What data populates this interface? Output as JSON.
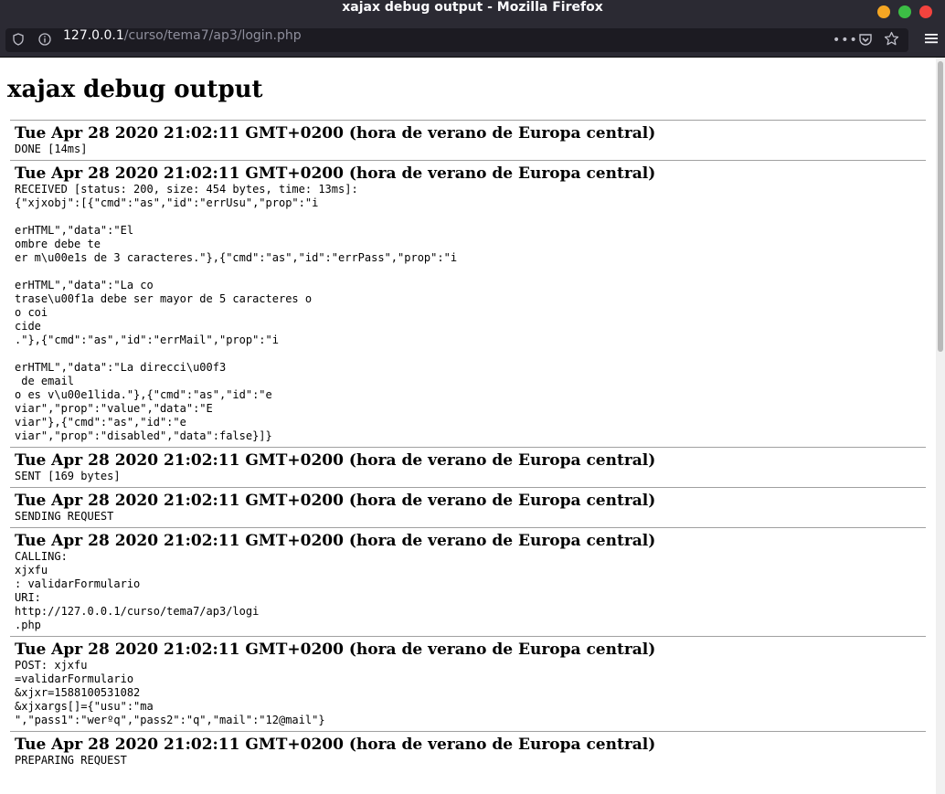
{
  "window": {
    "title": "xajax debug output - Mozilla Firefox",
    "controls": [
      "minimize",
      "maximize",
      "close"
    ],
    "control_colors": [
      "#f5a623",
      "#3cbe45",
      "#f3433e"
    ]
  },
  "urlbar": {
    "url_host": "127.0.0.1",
    "url_path": "/curso/tema7/ap3/login.php",
    "icons": [
      "shield-icon",
      "info-icon",
      "more-dots-icon",
      "pocket-icon",
      "star-icon"
    ]
  },
  "toolbar": {
    "menu_icon": "hamburger-menu-icon"
  },
  "page": {
    "title": "xajax debug output",
    "entries": [
      {
        "timestamp": "Tue Apr 28 2020 21:02:11 GMT+0200 (hora de verano de Europa central)",
        "body": "DONE [14ms]"
      },
      {
        "timestamp": "Tue Apr 28 2020 21:02:11 GMT+0200 (hora de verano de Europa central)",
        "body": "RECEIVED [status: 200, size: 454 bytes, time: 13ms]:\n{\"xjxobj\":[{\"cmd\":\"as\",\"id\":\"errUsu\",\"prop\":\"i\n\nerHTML\",\"data\":\"El\nombre debe te\ner m\\u00e1s de 3 caracteres.\"},{\"cmd\":\"as\",\"id\":\"errPass\",\"prop\":\"i\n\nerHTML\",\"data\":\"La co\ntrase\\u00f1a debe ser mayor de 5 caracteres o\no coi\ncide\n.\"},{\"cmd\":\"as\",\"id\":\"errMail\",\"prop\":\"i\n\nerHTML\",\"data\":\"La direcci\\u00f3\n de email\no es v\\u00e1lida.\"},{\"cmd\":\"as\",\"id\":\"e\nviar\",\"prop\":\"value\",\"data\":\"E\nviar\"},{\"cmd\":\"as\",\"id\":\"e\nviar\",\"prop\":\"disabled\",\"data\":false}]}"
      },
      {
        "timestamp": "Tue Apr 28 2020 21:02:11 GMT+0200 (hora de verano de Europa central)",
        "body": "SENT [169 bytes]"
      },
      {
        "timestamp": "Tue Apr 28 2020 21:02:11 GMT+0200 (hora de verano de Europa central)",
        "body": "SENDING REQUEST"
      },
      {
        "timestamp": "Tue Apr 28 2020 21:02:11 GMT+0200 (hora de verano de Europa central)",
        "body": "CALLING:\nxjxfu\n: validarFormulario\nURI:\nhttp://127.0.0.1/curso/tema7/ap3/logi\n.php"
      },
      {
        "timestamp": "Tue Apr 28 2020 21:02:11 GMT+0200 (hora de verano de Europa central)",
        "body": "POST: xjxfu\n=validarFormulario\n&xjxr=1588100531082\n&xjxargs[]={\"usu\":\"ma\n\",\"pass1\":\"werºq\",\"pass2\":\"q\",\"mail\":\"12@mail\"}"
      },
      {
        "timestamp": "Tue Apr 28 2020 21:02:11 GMT+0200 (hora de verano de Europa central)",
        "body": "PREPARING REQUEST"
      }
    ]
  }
}
